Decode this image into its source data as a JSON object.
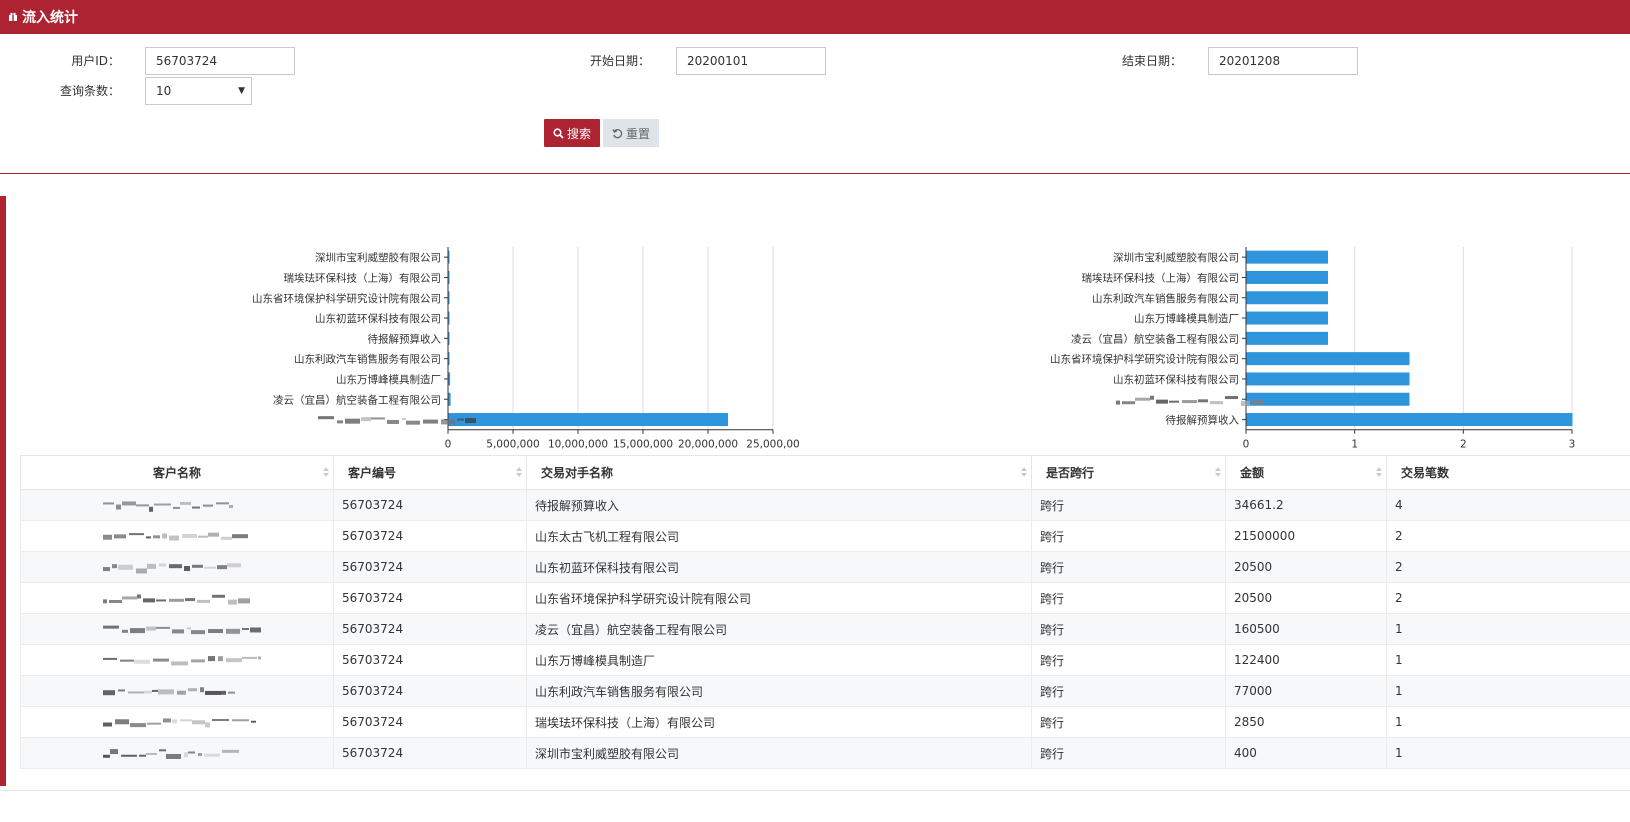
{
  "header": {
    "title": "流入统计"
  },
  "form": {
    "user_id_label": "用户ID：",
    "user_id_value": "56703724",
    "start_label": "开始日期：",
    "start_value": "20200101",
    "end_label": "结束日期：",
    "end_value": "20201208",
    "count_label": "查询条数：",
    "count_value": "10",
    "search_label": "搜索",
    "reset_label": "重置"
  },
  "colors": {
    "brand": "#ad2331",
    "bar": "#2e95dc"
  },
  "chart_data": [
    {
      "type": "bar",
      "orientation": "horizontal",
      "categories": [
        "深圳市宝利威塑胶有限公司",
        "瑞埃珐环保科技（上海）有限公司",
        "山东省环境保护科学研究设计院有限公司",
        "山东初蓝环保科技有限公司",
        "待报解预算收入",
        "山东利政汽车销售服务有限公司",
        "山东万博峰模具制造厂",
        "凌云（宜昌）航空装备工程有限公司",
        ""
      ],
      "values": [
        400,
        2850,
        20500,
        20500,
        34661.2,
        77000,
        122400,
        160500,
        21500000
      ],
      "xlim": [
        0,
        25000000
      ],
      "xticks": [
        "0",
        "5,000,000",
        "10,000,000",
        "15,000,000",
        "20,000,000",
        "25,000,00"
      ],
      "grid": true
    },
    {
      "type": "bar",
      "orientation": "horizontal",
      "categories": [
        "深圳市宝利威塑胶有限公司",
        "瑞埃珐环保科技（上海）有限公司",
        "山东利政汽车销售服务有限公司",
        "山东万博峰模具制造厂",
        "凌云（宜昌）航空装备工程有限公司",
        "山东省环境保护科学研究设计院有限公司",
        "山东初蓝环保科技有限公司",
        "",
        "待报解预算收入"
      ],
      "values": [
        1,
        1,
        1,
        1,
        1,
        2,
        2,
        2,
        4
      ],
      "xlim": [
        0,
        4
      ],
      "xticks": [
        "0",
        "1",
        "2",
        "3"
      ],
      "grid": true
    }
  ],
  "table": {
    "headers": [
      "客户名称",
      "客户编号",
      "交易对手名称",
      "是否跨行",
      "金额",
      "交易笔数"
    ],
    "rows": [
      {
        "name": "",
        "no": "56703724",
        "counterparty": "待报解预算收入",
        "cross": "跨行",
        "amount": "34661.2",
        "count": "4"
      },
      {
        "name": "",
        "no": "56703724",
        "counterparty": "山东太古飞机工程有限公司",
        "cross": "跨行",
        "amount": "21500000",
        "count": "2"
      },
      {
        "name": "",
        "no": "56703724",
        "counterparty": "山东初蓝环保科技有限公司",
        "cross": "跨行",
        "amount": "20500",
        "count": "2"
      },
      {
        "name": "",
        "no": "56703724",
        "counterparty": "山东省环境保护科学研究设计院有限公司",
        "cross": "跨行",
        "amount": "20500",
        "count": "2"
      },
      {
        "name": "",
        "no": "56703724",
        "counterparty": "凌云（宜昌）航空装备工程有限公司",
        "cross": "跨行",
        "amount": "160500",
        "count": "1"
      },
      {
        "name": "",
        "no": "56703724",
        "counterparty": "山东万博峰模具制造厂",
        "cross": "跨行",
        "amount": "122400",
        "count": "1"
      },
      {
        "name": "",
        "no": "56703724",
        "counterparty": "山东利政汽车销售服务有限公司",
        "cross": "跨行",
        "amount": "77000",
        "count": "1"
      },
      {
        "name": "",
        "no": "56703724",
        "counterparty": "瑞埃珐环保科技（上海）有限公司",
        "cross": "跨行",
        "amount": "2850",
        "count": "1"
      },
      {
        "name": "",
        "no": "56703724",
        "counterparty": "深圳市宝利威塑胶有限公司",
        "cross": "跨行",
        "amount": "400",
        "count": "1"
      }
    ]
  }
}
